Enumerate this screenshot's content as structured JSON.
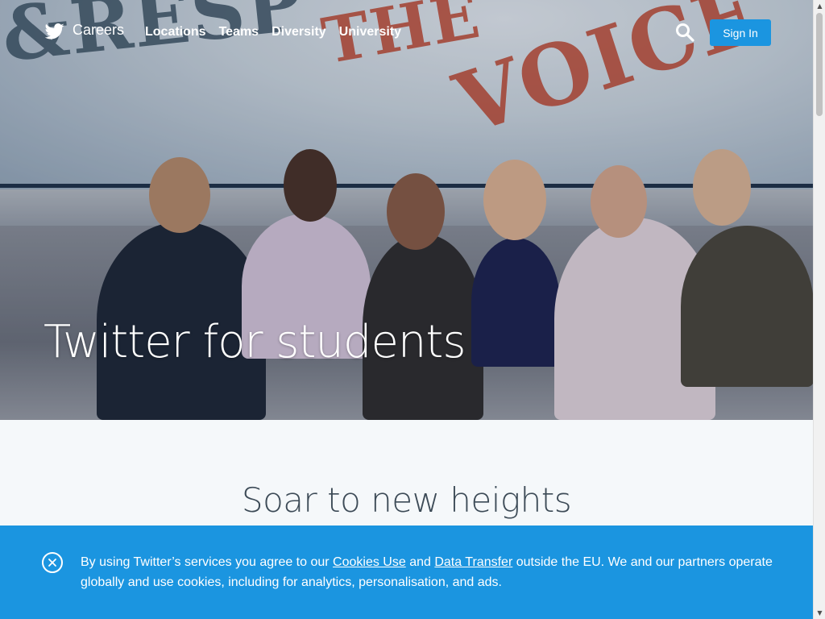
{
  "nav": {
    "brand": "Careers",
    "links": [
      "Locations",
      "Teams",
      "Diversity",
      "University"
    ],
    "sign_in": "Sign In",
    "search_icon": "search-icon",
    "logo_icon": "twitter-bird-icon"
  },
  "hero": {
    "title": "Twitter for students"
  },
  "section": {
    "title": "Soar to new heights"
  },
  "cookie": {
    "text_1": "By using Twitter’s services you agree to our ",
    "link_1": "Cookies Use",
    "text_2": " and ",
    "link_2": "Data Transfer",
    "text_3": " outside the EU. We and our partners operate globally and use cookies, including for analytics, personalisation, and ads.",
    "close_icon": "close-icon"
  },
  "colors": {
    "accent": "#1b95e0",
    "section_bg": "#f5f8fa",
    "heading_text": "#3d4b57"
  }
}
